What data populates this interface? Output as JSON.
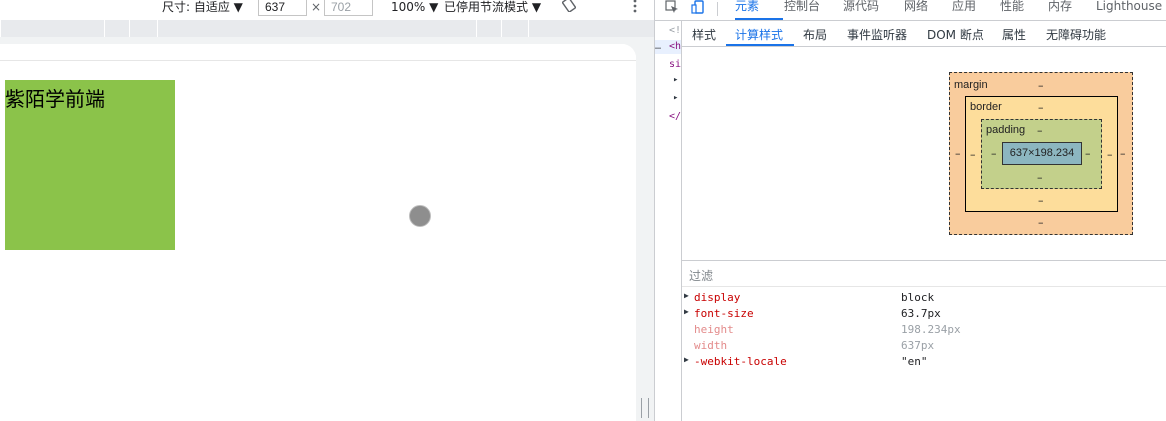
{
  "device_toolbar": {
    "dimensions_label": "尺寸: 自适应 ▼",
    "width_value": "637",
    "times_symbol": "×",
    "height_placeholder": "702",
    "zoom_label": "100% ▼",
    "throttle_label": "已停用节流模式 ▼"
  },
  "page": {
    "box_text": "紫陌学前端",
    "box_color": "#8bc34a"
  },
  "devtools": {
    "main_tabs": [
      "元素",
      "控制台",
      "源代码",
      "网络",
      "应用",
      "性能",
      "内存",
      "Lighthouse"
    ],
    "active_main_tab": "元素",
    "sub_tabs": [
      "样式",
      "计算样式",
      "布局",
      "事件监听器",
      "DOM 断点",
      "属性",
      "无障碍功能"
    ],
    "active_sub_tab": "计算样式",
    "dom_tree_lines": [
      "<!",
      "<h",
      "si",
      "▸",
      "▸",
      "</"
    ],
    "box_model": {
      "margin_label": "margin",
      "border_label": "border",
      "padding_label": "padding",
      "content_size": "637×198.234",
      "dash": "–"
    },
    "filter_placeholder": "过滤",
    "computed_properties": [
      {
        "name": "display",
        "value": "block",
        "expandable": true,
        "dim": false
      },
      {
        "name": "font-size",
        "value": "63.7px",
        "expandable": true,
        "dim": false
      },
      {
        "name": "height",
        "value": "198.234px",
        "expandable": false,
        "dim": true
      },
      {
        "name": "width",
        "value": "637px",
        "expandable": false,
        "dim": true
      },
      {
        "name": "-webkit-locale",
        "value": "\"en\"",
        "expandable": true,
        "dim": false
      }
    ]
  },
  "colors": {
    "accent": "#1a73e8",
    "margin_color": "#f9cc9d",
    "border_color": "#fddd9b",
    "padding_color": "#c3d08b",
    "content_color": "#8cb6c0"
  }
}
